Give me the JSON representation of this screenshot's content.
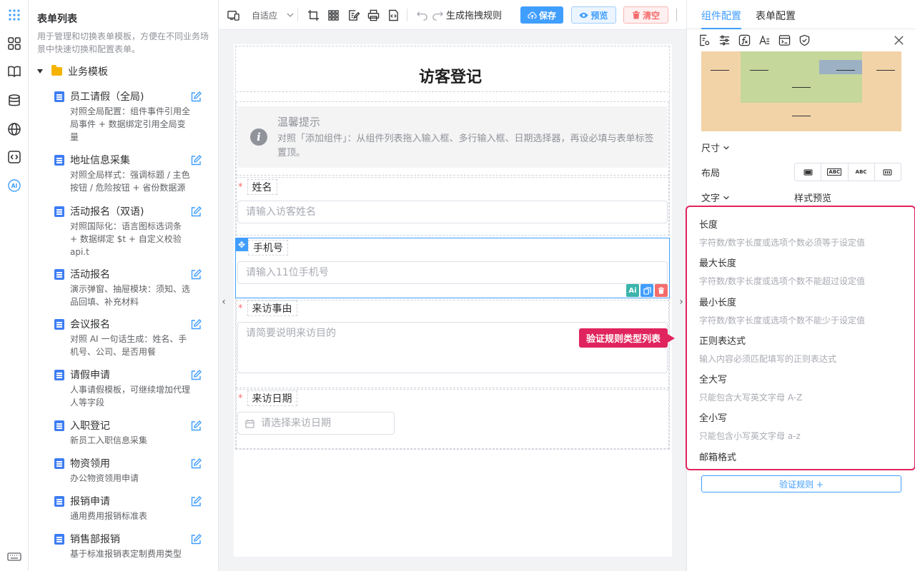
{
  "list": {
    "title": "表单列表",
    "desc": "用于管理和切换表单模板，方便在不同业务场景中快速切换和配置表单。",
    "group": "业务模板",
    "items": [
      {
        "name": "员工请假（全局)",
        "desc": "对照全局配置：组件事件引用全局事件 + 数据绑定引用全局变量"
      },
      {
        "name": "地址信息采集",
        "desc": "对照全局样式：强调标题 / 主色按钮 / 危险按钮 + 省份数据源"
      },
      {
        "name": "活动报名（双语)",
        "desc": "对照国际化：语言图标选词条 + 数据绑定 $t + 自定义校验 api.t"
      },
      {
        "name": "活动报名",
        "desc": "演示弹窗、抽屉模块：须知、选品回填、补充材料"
      },
      {
        "name": "会议报名",
        "desc": "对照 AI 一句话生成：姓名、手机号、公司、是否用餐"
      },
      {
        "name": "请假申请",
        "desc": "人事请假模板，可继续增加代理人等字段"
      },
      {
        "name": "入职登记",
        "desc": "新员工入职信息采集"
      },
      {
        "name": "物资领用",
        "desc": "办公物资领用申请"
      },
      {
        "name": "报销申请",
        "desc": "通用费用报销标准表"
      },
      {
        "name": "销售部报销",
        "desc": "基于标准报销表定制费用类型"
      }
    ]
  },
  "toolbar": {
    "adapt": "自适应",
    "generate": "生成拖拽规则",
    "save": "保存",
    "preview": "预览",
    "clear": "清空"
  },
  "canvas": {
    "title": "访客登记",
    "tip_title": "温馨提示",
    "tip_text": "对照「添加组件」：从组件列表拖入输入框、多行输入框、日期选择器，再设必填与表单标签置顶。",
    "fields": [
      {
        "label": "姓名",
        "placeholder": "请输入访客姓名",
        "required": true
      },
      {
        "label": "手机号",
        "placeholder": "请输入11位手机号",
        "required": false
      },
      {
        "label": "来访事由",
        "placeholder": "请简要说明来访目的",
        "required": true
      },
      {
        "label": "来访日期",
        "placeholder": "请选择来访日期",
        "required": true
      }
    ],
    "ai_badge": "Ai"
  },
  "callout": "验证规则类型列表",
  "right": {
    "tabs": [
      "组件配置",
      "表单配置"
    ],
    "size_label": "尺寸",
    "layout_label": "布局",
    "text_label": "文字",
    "style_preview": "样式预览",
    "layout_options": [
      "",
      "ABC",
      "ABC",
      ""
    ],
    "rules": [
      {
        "name": "长度",
        "desc": "字符数/数字长度或选项个数必须等于设定值"
      },
      {
        "name": "最大长度",
        "desc": "字符数/数字长度或选项个数不能超过设定值"
      },
      {
        "name": "最小长度",
        "desc": "字符数/数字长度或选项个数不能少于设定值"
      },
      {
        "name": "正则表达式",
        "desc": "输入内容必须匹配填写的正则表达式"
      },
      {
        "name": "全大写",
        "desc": "只能包含大写英文字母 A-Z"
      },
      {
        "name": "全小写",
        "desc": "只能包含小写英文字母 a-z"
      },
      {
        "name": "邮箱格式",
        "desc": ""
      }
    ],
    "validate_button": "验证规则 +"
  },
  "colors": {
    "primary": "#409eff",
    "danger": "#f56c6c",
    "highlight": "#e0245e",
    "folder": "#f5b300"
  }
}
